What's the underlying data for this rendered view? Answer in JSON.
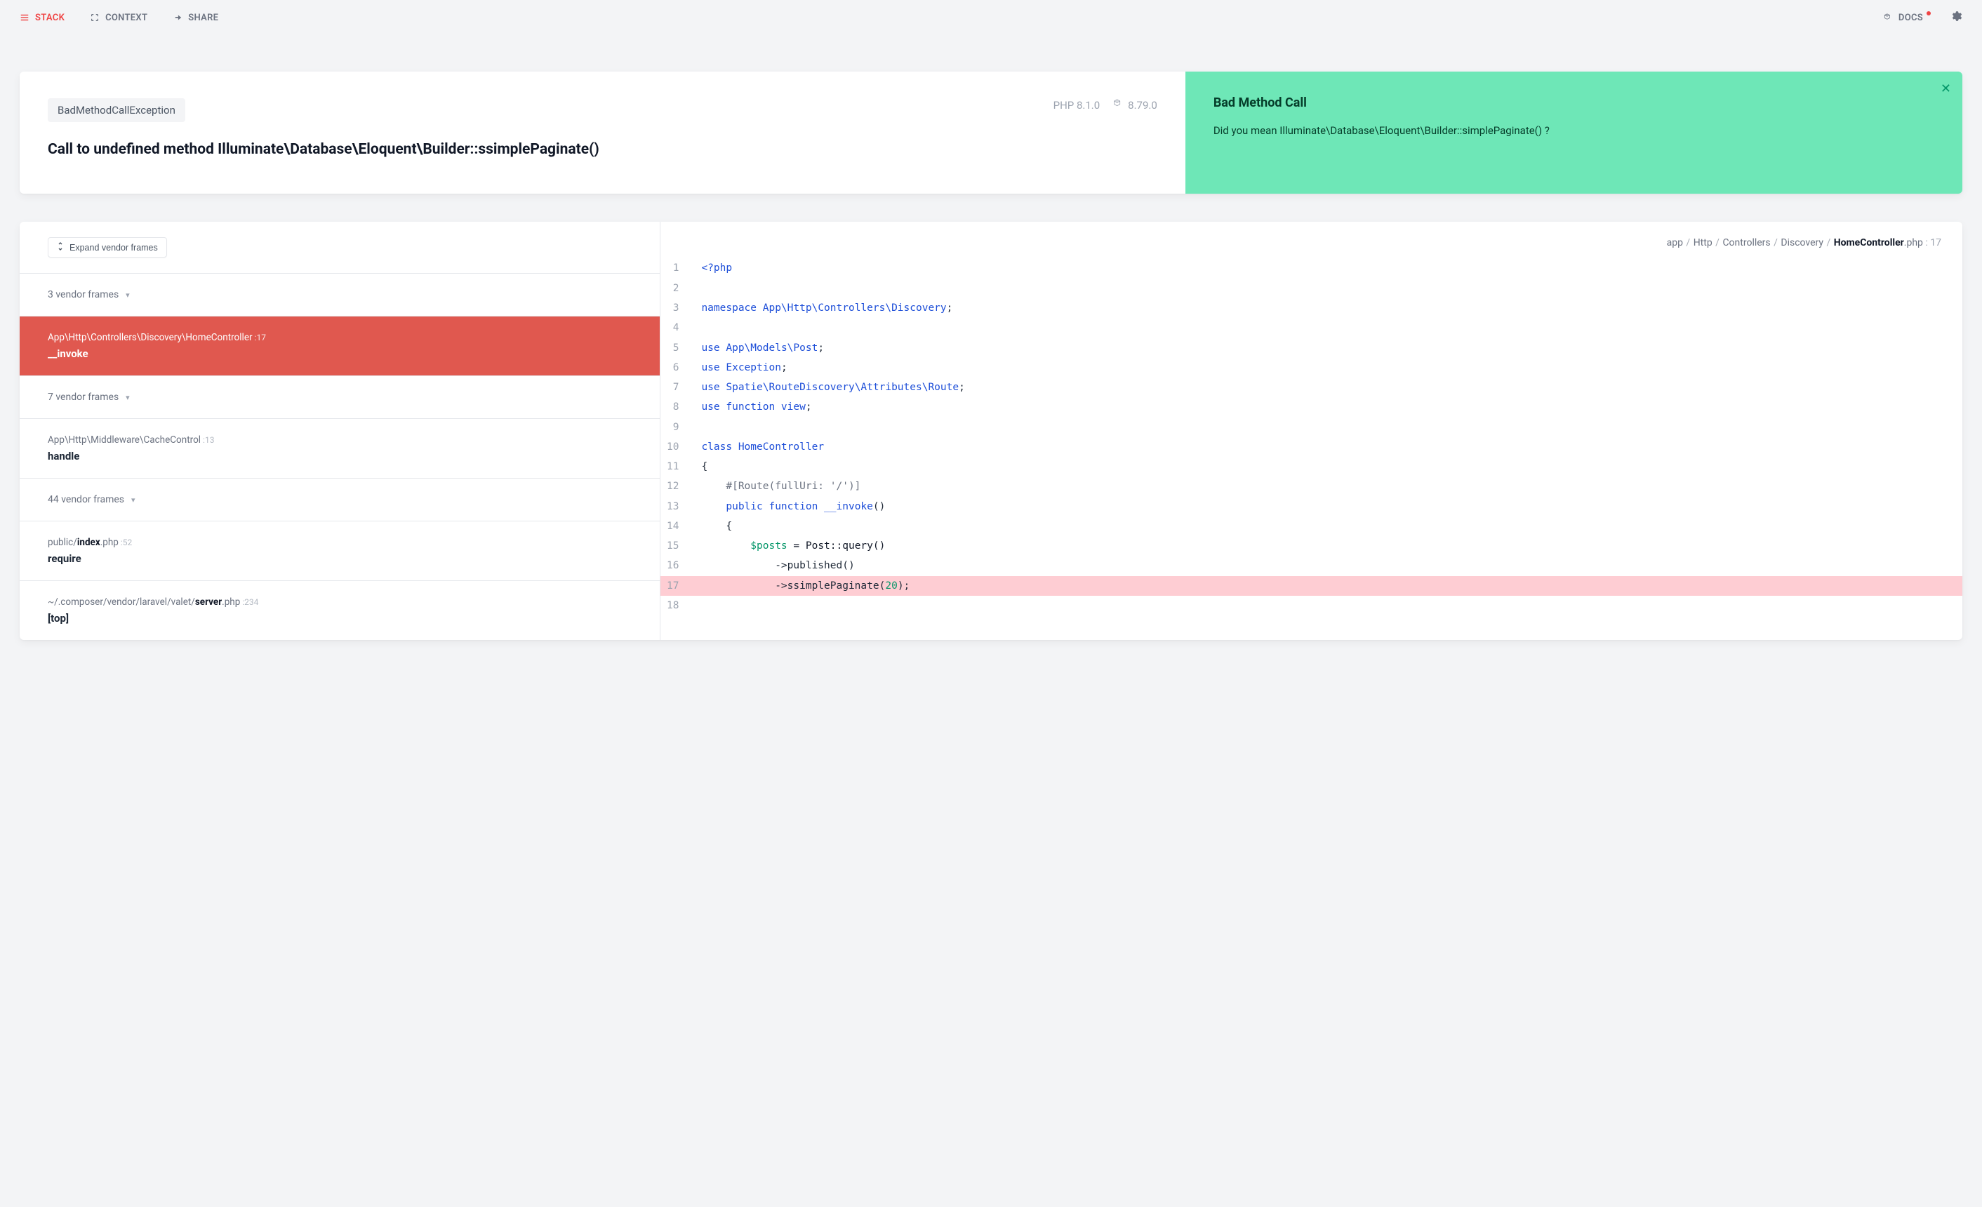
{
  "nav": {
    "stack": "STACK",
    "context": "CONTEXT",
    "share": "SHARE",
    "docs": "DOCS"
  },
  "error": {
    "exception_class": "BadMethodCallException",
    "message": "Call to undefined method Illuminate\\Database\\Eloquent\\Builder::ssimplePaginate()",
    "php_version": "PHP 8.1.0",
    "laravel_version": "8.79.0"
  },
  "solution": {
    "title": "Bad Method Call",
    "text": "Did you mean Illuminate\\Database\\Eloquent\\Builder::simplePaginate() ?"
  },
  "stack": {
    "expand_label": "Expand vendor frames",
    "frames": [
      {
        "type": "collapsed",
        "label": "3 vendor frames"
      },
      {
        "type": "active",
        "path": "App\\Http\\Controllers\\Discovery\\HomeController",
        "line": "17",
        "method": "__invoke"
      },
      {
        "type": "collapsed",
        "label": "7 vendor frames"
      },
      {
        "type": "normal",
        "path": "App\\Http\\Middleware\\CacheControl",
        "line": "13",
        "method": "handle"
      },
      {
        "type": "collapsed",
        "label": "44 vendor frames"
      },
      {
        "type": "file",
        "path_pre": "public/",
        "path_strong": "index",
        "path_post": ".php",
        "line": "52",
        "method": "require"
      },
      {
        "type": "file",
        "path_pre": "~/.composer/vendor/laravel/valet/",
        "path_strong": "server",
        "path_post": ".php",
        "line": "234",
        "method": "[top]"
      }
    ]
  },
  "code": {
    "path_segments": [
      "app",
      "Http",
      "Controllers",
      "Discovery"
    ],
    "file_strong": "HomeController",
    "file_ext": ".php",
    "line": "17",
    "highlight_line": 17,
    "lines": [
      {
        "n": 1,
        "tokens": [
          [
            "kw",
            "<?php"
          ]
        ]
      },
      {
        "n": 2,
        "tokens": []
      },
      {
        "n": 3,
        "tokens": [
          [
            "kw",
            "namespace"
          ],
          [
            "",
            ""
          ],
          [
            "ns",
            " App\\Http\\Controllers\\Discovery"
          ],
          [
            "",
            ";"
          ]
        ]
      },
      {
        "n": 4,
        "tokens": []
      },
      {
        "n": 5,
        "tokens": [
          [
            "kw",
            "use"
          ],
          [
            "ns",
            " App\\Models\\Post"
          ],
          [
            "",
            ";"
          ]
        ]
      },
      {
        "n": 6,
        "tokens": [
          [
            "kw",
            "use"
          ],
          [
            "ns",
            " Exception"
          ],
          [
            "",
            ";"
          ]
        ]
      },
      {
        "n": 7,
        "tokens": [
          [
            "kw",
            "use"
          ],
          [
            "ns",
            " Spatie\\RouteDiscovery\\Attributes\\Route"
          ],
          [
            "",
            ";"
          ]
        ]
      },
      {
        "n": 8,
        "tokens": [
          [
            "kw",
            "use function"
          ],
          [
            "ns",
            " view"
          ],
          [
            "",
            ";"
          ]
        ]
      },
      {
        "n": 9,
        "tokens": []
      },
      {
        "n": 10,
        "tokens": [
          [
            "kw",
            "class "
          ],
          [
            "ns",
            "HomeController"
          ]
        ]
      },
      {
        "n": 11,
        "tokens": [
          [
            "",
            "{"
          ]
        ]
      },
      {
        "n": 12,
        "tokens": [
          [
            "",
            "    "
          ],
          [
            "cm",
            "#[Route(fullUri: '/')]"
          ]
        ]
      },
      {
        "n": 13,
        "tokens": [
          [
            "",
            "    "
          ],
          [
            "kw",
            "public function "
          ],
          [
            "ns",
            "__invoke"
          ],
          [
            "",
            "()"
          ]
        ]
      },
      {
        "n": 14,
        "tokens": [
          [
            "",
            "    {"
          ]
        ]
      },
      {
        "n": 15,
        "tokens": [
          [
            "",
            "        "
          ],
          [
            "var",
            "$posts"
          ],
          [
            "",
            ""
          ],
          [
            "fn",
            " = Post::query()"
          ]
        ]
      },
      {
        "n": 16,
        "tokens": [
          [
            "",
            "            ->published()"
          ]
        ]
      },
      {
        "n": 17,
        "tokens": [
          [
            "",
            "            ->ssimplePaginate("
          ],
          [
            "num",
            "20"
          ],
          [
            "",
            ");"
          ]
        ]
      },
      {
        "n": 18,
        "tokens": []
      }
    ]
  }
}
